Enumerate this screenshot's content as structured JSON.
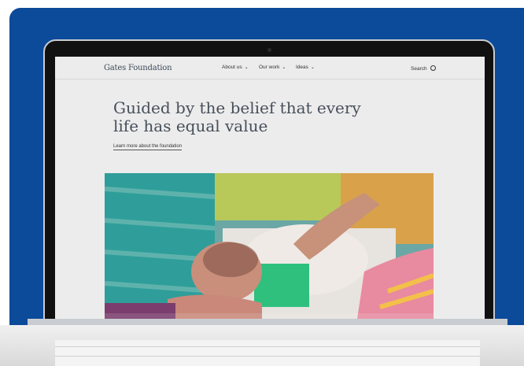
{
  "site": {
    "logo": "Gates Foundation",
    "nav": [
      {
        "label": "About us"
      },
      {
        "label": "Our work"
      },
      {
        "label": "Ideas"
      }
    ],
    "search_label": "Search"
  },
  "hero": {
    "headline_line1": "Guided by the belief that every",
    "headline_line2": "life has equal value",
    "link_label": "Learn more about the foundation"
  },
  "colors": {
    "background_blue": "#0c4a9a",
    "text_slate": "#474f5b"
  },
  "icons": [
    "chevron-down-icon",
    "search-icon"
  ]
}
